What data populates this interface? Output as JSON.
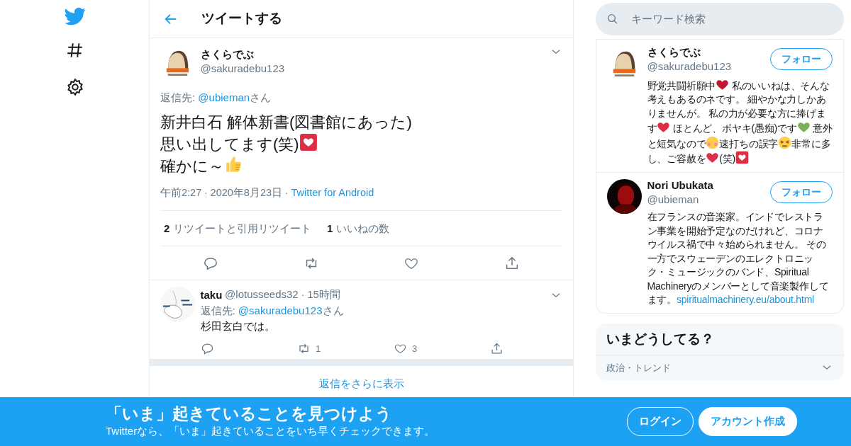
{
  "header": {
    "title": "ツイートする"
  },
  "tweet": {
    "author": {
      "name": "さくらでぶ",
      "handle": "@sakuradebu123"
    },
    "reply_to": {
      "prefix": "返信先: ",
      "handle": "@ubieman",
      "suffix": "さん"
    },
    "body": [
      [
        {
          "kind": "text",
          "text": "新井白石 解体新書(図書館にあった)"
        }
      ],
      [
        {
          "kind": "text",
          "text": "思い出してます(笑)"
        },
        {
          "kind": "heartbox",
          "color": "#dd2e44"
        }
      ],
      [
        {
          "kind": "text",
          "text": "確かに～"
        },
        {
          "kind": "thumbs",
          "color": "#ffcc4d"
        }
      ]
    ],
    "meta": {
      "time": "午前2:27",
      "separator": "·",
      "date": "2020年8月23日",
      "source": "Twitter for Android"
    },
    "stats": [
      {
        "count": "2",
        "label": "リツイートと引用リツイート"
      },
      {
        "count": "1",
        "label": "いいねの数"
      }
    ]
  },
  "reply": {
    "name": "taku",
    "handle": "@lotusseeds32",
    "separator": "·",
    "time": "15時間",
    "reply_to": {
      "prefix": "返信先: ",
      "handle": "@sakuradebu123",
      "suffix": "さん"
    },
    "text": "杉田玄白では。",
    "retweets": "1",
    "likes": "3"
  },
  "more_replies": "返信をさらに表示",
  "search": {
    "placeholder": "キーワード検索"
  },
  "users": [
    {
      "name": "さくらでぶ",
      "handle": "@sakuradebu123",
      "avatar": {
        "kind": "picture"
      },
      "follow": "フォロー",
      "bio": [
        {
          "kind": "text",
          "text": "野党共闘祈願中"
        },
        {
          "kind": "heart",
          "color": "#be1931"
        },
        {
          "kind": "text",
          "text": " 私のいいねは、そんな考えもあるのネです。 細やかな力しかありませんが。 私の力が必要な方に捧げます"
        },
        {
          "kind": "heart",
          "color": "#dd2e44"
        },
        {
          "kind": "text",
          "text": " ほとんど、ボヤキ(愚痴)です"
        },
        {
          "kind": "heart",
          "color": "#77b255"
        },
        {
          "kind": "text",
          "text": " 意外と短気なので"
        },
        {
          "kind": "flushed",
          "color": "#ffcc4d"
        },
        {
          "kind": "text",
          "text": "速打ちの誤字"
        },
        {
          "kind": "tired",
          "color": "#ffcc4d"
        },
        {
          "kind": "text",
          "text": "非常に多し、ご容赦を"
        },
        {
          "kind": "heart",
          "color": "#dd2e44"
        },
        {
          "kind": "text",
          "text": "(笑)"
        },
        {
          "kind": "heartbox",
          "color": "#dd2e44"
        }
      ]
    },
    {
      "name": "Nori Ubukata",
      "handle": "@ubieman",
      "avatar": {
        "kind": "picture"
      },
      "follow": "フォロー",
      "bio": [
        {
          "kind": "text",
          "text": "在フランスの音楽家。インドでレストラン事業を開始予定なのだけれど、コロナウイルス禍で中々始められません。 その一方でスウェーデンのエレクトロニック・ミュージックのバンド、Spiritual Machineryのメンバーとして音楽製作してます。"
        },
        {
          "kind": "link",
          "text": "spiritualmachinery.eu/about.html"
        }
      ]
    }
  ],
  "trends": {
    "title": "いまどうしてる？",
    "items": [
      {
        "context": "政治・トレンド"
      }
    ]
  },
  "banner": {
    "title": "「いま」起きていることを見つけよう",
    "subtitle": "Twitterなら、「いま」起きていることをいち早くチェックできます。",
    "buttons": [
      {
        "label": "ログイン",
        "kind": "outline"
      },
      {
        "label": "アカウント作成",
        "kind": "solid"
      }
    ]
  }
}
